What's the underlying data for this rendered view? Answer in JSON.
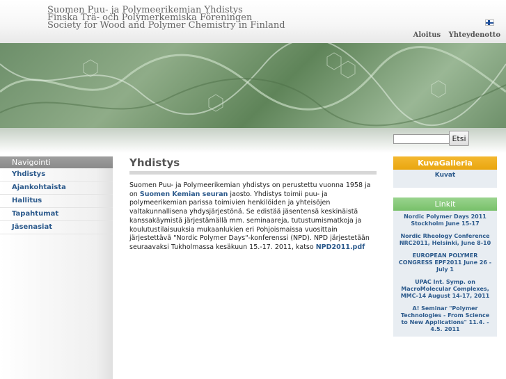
{
  "header": {
    "title_lines": [
      "Suomen Puu- ja Polymeerikemian Yhdistys",
      "Finska Trä- och Polymerkemiska Föreningen",
      "Society for Wood and Polymer Chemistry in Finland"
    ],
    "nav": [
      "Aloitus",
      "Yhteydenotto"
    ]
  },
  "search": {
    "placeholder": "",
    "button_label": "Etsi"
  },
  "sidebar": {
    "title": "Navigointi",
    "items": [
      "Yhdistys",
      "Ajankohtaista",
      "Hallitus",
      "Tapahtumat",
      "Jäsenasiat"
    ]
  },
  "main": {
    "title": "Yhdistys",
    "p1": "Suomen Puu- ja Polymeerikemian yhdistys on perustettu vuonna 1958 ja on ",
    "link1": "Suomen Kemian seuran",
    "p2": " jaosto. Yhdistys toimii puu- ja polymeerikemian parissa toimivien henkilöiden ja yhteisöjen valtakunnallisena yhdysjärjestönä. Se edistää jäsentensä keskinäistä kanssakäymistä järjestämällä mm. seminaareja, tutustumismatkoja ja koulutustilaisuuksia mukaanlukien eri Pohjoismaissa vuosittain järjestettävä \"Nordic Polymer Days\"-konferenssi (NPD). NPD järjestetään seuraavaksi Tukholmassa kesäkuun 15.-17. 2011, katso ",
    "link2": "NPD2011.pdf"
  },
  "gallery": {
    "title": "KuvaGalleria",
    "link": "Kuvat"
  },
  "links": {
    "title": "Linkit",
    "items": [
      "Nordic Polymer Days 2011 Stockholm June 15-17",
      "Nordic Rheology Conference NRC2011, Helsinki, June 8-10",
      "EUROPEAN POLYMER CONGRESS EPF2011 June 26 - July 1",
      "UPAC Int. Symp. on MacroMolecular Complexes, MMC-14 August 14-17, 2011",
      "A! Seminar \"Polymer Technologies - From Science to New Applications\" 11.4. - 4.5. 2011"
    ]
  },
  "colors": {
    "link": "#2c5a8c",
    "sidebar_header": "#9e9e9e",
    "gallery_header": "#f4b830",
    "links_header": "#9ad48e",
    "banner": "#6d8f6a"
  }
}
